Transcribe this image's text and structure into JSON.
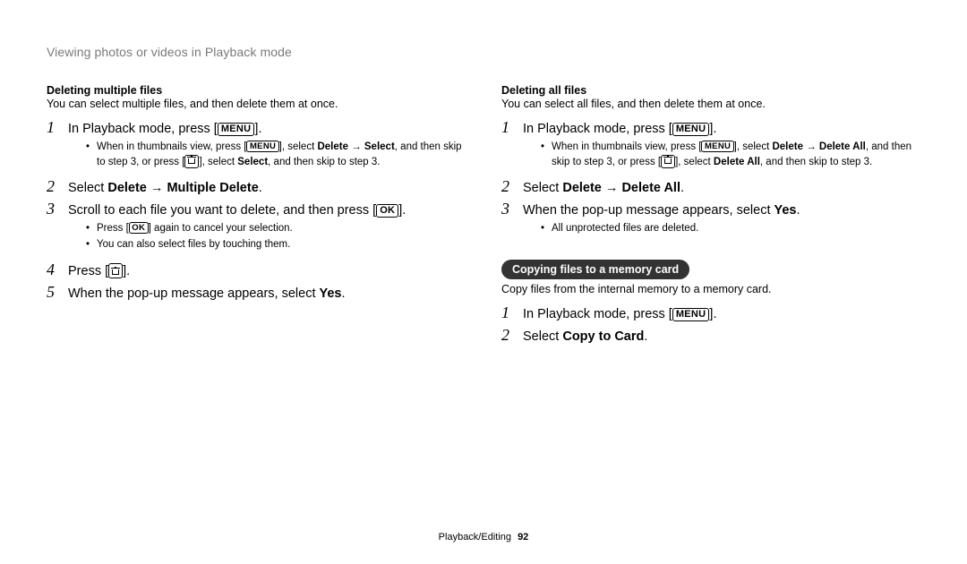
{
  "section_heading": "Viewing photos or videos in Playback mode",
  "icons": {
    "menu": "MENU",
    "ok": "OK"
  },
  "left": {
    "title": "Deleting multiple files",
    "desc": "You can select multiple files, and then delete them at once.",
    "steps": {
      "s1_pre": "In Playback mode, press [",
      "s1_post": "].",
      "s1_tip_pre": "When in thumbnails view, press [",
      "s1_tip_mid1": "], select ",
      "s1_tip_b1": "Delete",
      "s1_tip_mid2": " → ",
      "s1_tip_b2": "Select",
      "s1_tip_mid3": ", and then skip to step 3, or press [",
      "s1_tip_mid4": "], select ",
      "s1_tip_b3": "Select",
      "s1_tip_mid5": ", and then skip to step 3.",
      "s2_pre": "Select ",
      "s2_b1": "Delete",
      "s2_mid": " → ",
      "s2_b2": "Multiple Delete",
      "s2_post": ".",
      "s3_pre": "Scroll to each file you want to delete, and then press [",
      "s3_post": "].",
      "s3_tip1_pre": "Press [",
      "s3_tip1_post": "] again to cancel your selection.",
      "s3_tip2": "You can also select files by touching them.",
      "s4_pre": "Press [",
      "s4_post": "].",
      "s5_pre": "When the pop-up message appears, select ",
      "s5_b": "Yes",
      "s5_post": "."
    }
  },
  "right": {
    "title": "Deleting all files",
    "desc": "You can select all files, and then delete them at once.",
    "steps": {
      "s1_pre": "In Playback mode, press [",
      "s1_post": "].",
      "s1_tip_pre": "When in thumbnails view, press [",
      "s1_tip_mid1": "], select ",
      "s1_tip_b1": "Delete",
      "s1_tip_mid2": " → ",
      "s1_tip_b2": "Delete All",
      "s1_tip_mid3": ", and then skip to step 3, or press [",
      "s1_tip_mid4": "], select ",
      "s1_tip_b3": "Delete All",
      "s1_tip_mid5": ", and then skip to step 3.",
      "s2_pre": "Select ",
      "s2_b1": "Delete",
      "s2_mid": " → ",
      "s2_b2": "Delete All",
      "s2_post": ".",
      "s3_pre": "When the pop-up message appears, select ",
      "s3_b": "Yes",
      "s3_post": ".",
      "s3_tip": "All unprotected files are deleted."
    },
    "copy": {
      "pill": "Copying files to a memory card",
      "desc": "Copy files from the internal memory to a memory card.",
      "s1_pre": "In Playback mode, press [",
      "s1_post": "].",
      "s2_pre": "Select ",
      "s2_b": "Copy to Card",
      "s2_post": "."
    }
  },
  "footer": {
    "section": "Playback/Editing",
    "page": "92"
  }
}
